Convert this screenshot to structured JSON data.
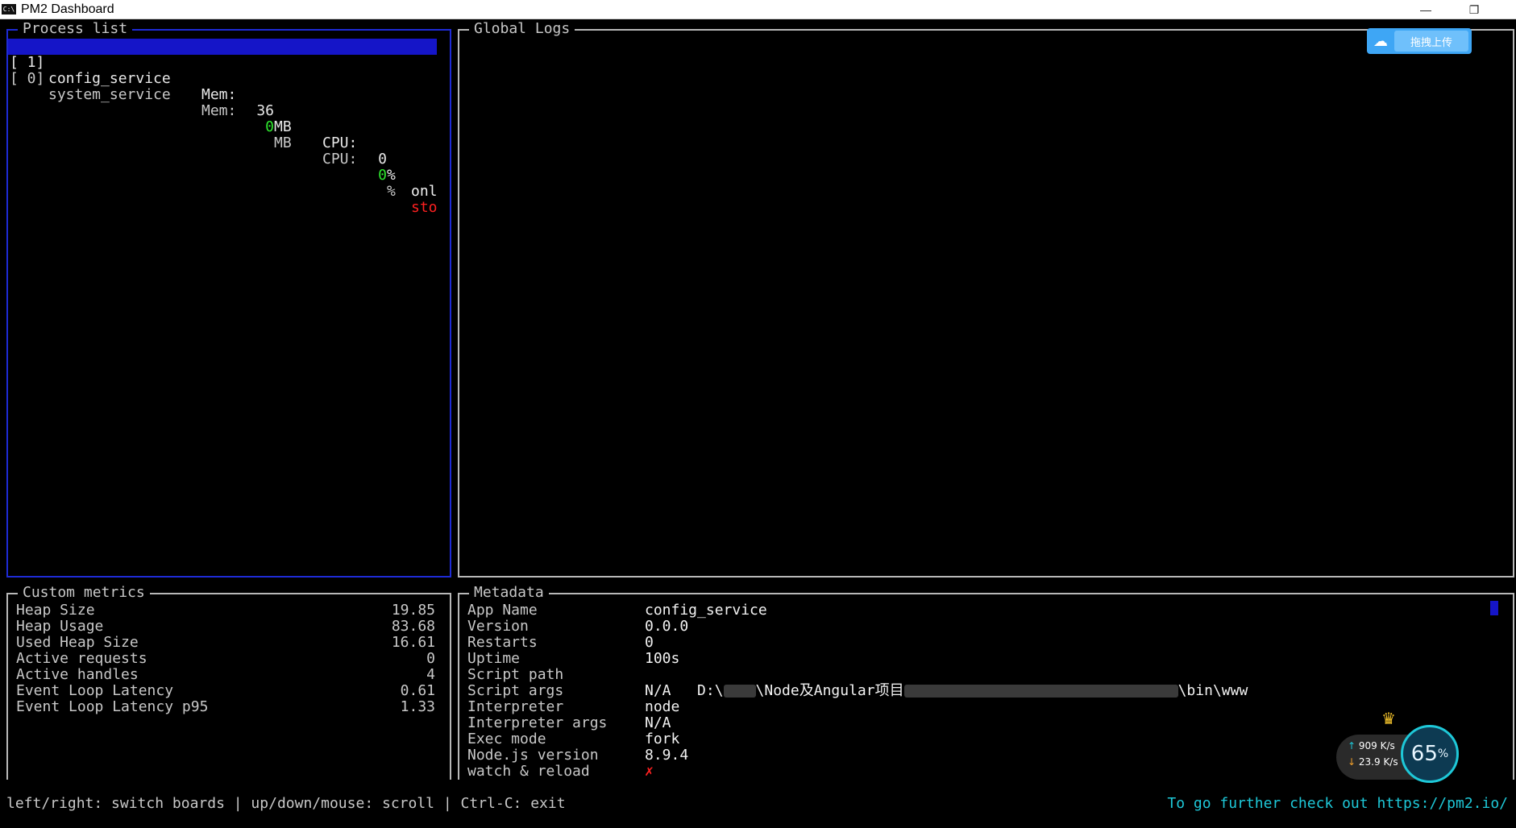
{
  "window": {
    "title": "PM2 Dashboard",
    "minimize_glyph": "—",
    "restore_glyph": "❐",
    "icon_text": "C:\\"
  },
  "process_list": {
    "title": "Process list",
    "rows": [
      {
        "id": "[ 1]",
        "name": "config_service",
        "mem_label": "Mem:",
        "mem": "36",
        "mem_unit": "MB",
        "cpu_label": "CPU:",
        "cpu": "0",
        "cpu_unit": "%",
        "status": "onl",
        "selected": true
      },
      {
        "id": "[ 0]",
        "name": "system_service",
        "mem_label": "Mem:",
        "mem": "0",
        "mem_unit": "MB",
        "cpu_label": "CPU:",
        "cpu": "0",
        "cpu_unit": "%",
        "status": "sto",
        "selected": false
      }
    ]
  },
  "global_logs": {
    "title": "Global Logs"
  },
  "upload_button": {
    "label": "拖拽上传",
    "icon": "cloud-icon"
  },
  "custom_metrics": {
    "title": "Custom metrics",
    "items": [
      {
        "label": "Heap Size",
        "value": "19.85"
      },
      {
        "label": "Heap Usage",
        "value": "83.68"
      },
      {
        "label": "Used Heap Size",
        "value": "16.61"
      },
      {
        "label": "Active requests",
        "value": "0"
      },
      {
        "label": "Active handles",
        "value": "4"
      },
      {
        "label": "Event Loop Latency",
        "value": "0.61"
      },
      {
        "label": "Event Loop Latency p95",
        "value": "1.33"
      }
    ]
  },
  "metadata": {
    "title": "Metadata",
    "items": [
      {
        "key": "App Name",
        "value": "config_service"
      },
      {
        "key": "Version",
        "value": "0.0.0"
      },
      {
        "key": "Restarts",
        "value": "0"
      },
      {
        "key": "Uptime",
        "value": "100s"
      },
      {
        "key": "Script path",
        "value_prefix": "D:\\",
        "value_mid": "\\Node及Angular项目",
        "value_suffix": "\\bin\\www"
      },
      {
        "key": "Script args",
        "value": "N/A"
      },
      {
        "key": "Interpreter",
        "value": "node"
      },
      {
        "key": "Interpreter args",
        "value": "N/A"
      },
      {
        "key": "Exec mode",
        "value": "fork"
      },
      {
        "key": "Node.js version",
        "value": "8.9.4"
      },
      {
        "key": "watch & reload",
        "value": "✗"
      }
    ]
  },
  "footer": {
    "help": "left/right: switch boards | up/down/mouse: scroll | Ctrl-C: exit",
    "link_text": "To go further check out https://pm2.io/"
  },
  "net_widget": {
    "upload_speed": "909",
    "upload_unit": "K/s",
    "download_speed": "23.9",
    "download_unit": "K/s",
    "percent": "65",
    "percent_unit": "%"
  },
  "colors": {
    "selected_row_bg": "#1515c8",
    "panel_border_active": "#1e2bd6",
    "status_online": "#f2f2f2",
    "status_stopped": "#ff2020",
    "value_green": "#2ee82e",
    "link": "#1ec8d8"
  }
}
